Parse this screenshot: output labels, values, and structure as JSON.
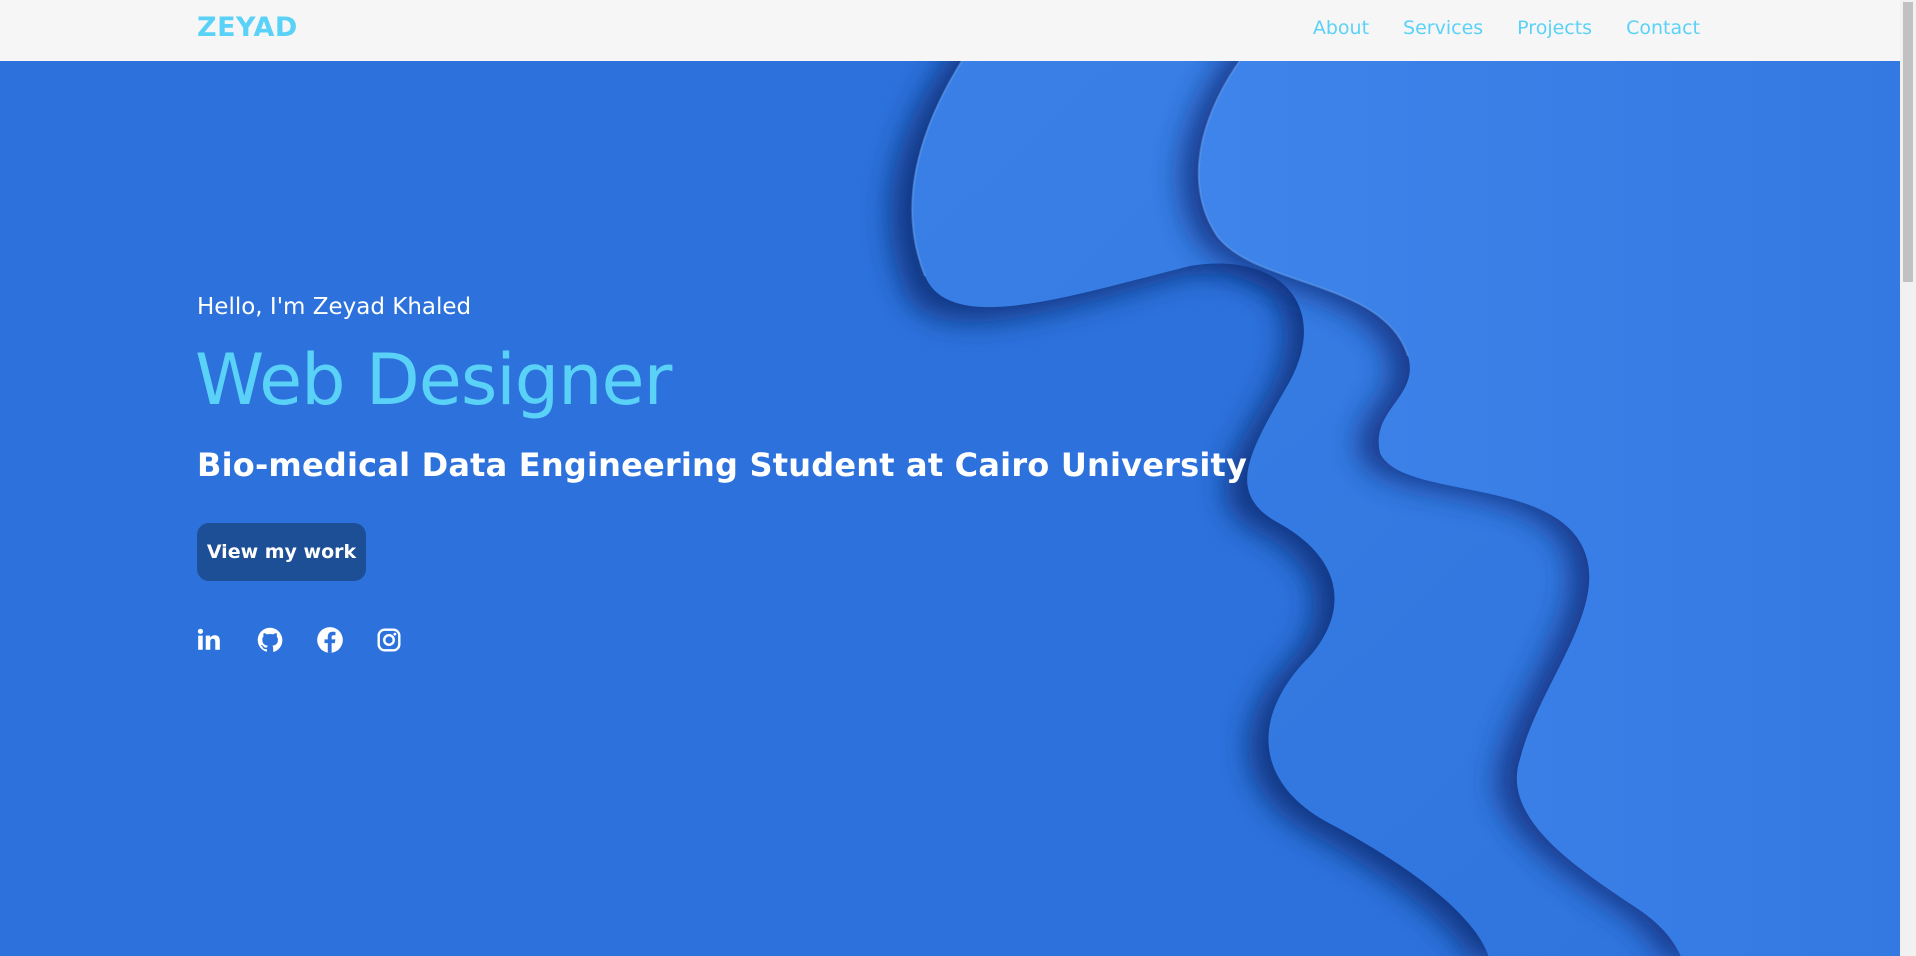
{
  "nav": {
    "logo": "ZEYAD",
    "links": [
      "About",
      "Services",
      "Projects",
      "Contact"
    ]
  },
  "hero": {
    "greeting": "Hello, I'm Zeyad Khaled",
    "role": "Web Designer",
    "subtitle": "Bio-medical Data Engineering Student at Cairo University",
    "cta_label": "View my work"
  },
  "socials": [
    "linkedin-icon",
    "github-icon",
    "facebook-icon",
    "instagram-icon"
  ],
  "colors": {
    "accent": "#5ad2f7",
    "hero_bg": "#2c71dc",
    "button_bg": "#1c4f95",
    "nav_bg": "#f6f6f6"
  }
}
